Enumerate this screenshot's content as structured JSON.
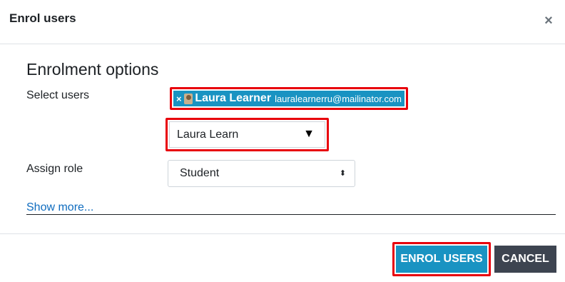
{
  "modal": {
    "title": "Enrol users",
    "close_glyph": "×"
  },
  "enrolment": {
    "heading": "Enrolment options",
    "select_users_label": "Select users",
    "selected_user": {
      "remove_glyph": "×",
      "avatar_icon": "user-avatar-icon",
      "name": "Laura Learner",
      "email": "lauralearnerru@mailinator.com"
    },
    "search": {
      "value": "Laura Learn",
      "arrow_glyph": "▼"
    },
    "assign_role_label": "Assign role",
    "role_select": {
      "value": "Student",
      "icon_glyph": "⬍"
    },
    "show_more": "Show more..."
  },
  "footer": {
    "enrol_label": "ENROL USERS",
    "cancel_label": "CANCEL"
  },
  "colors": {
    "accent": "#1993c2",
    "highlight": "#e8000b",
    "cancel_bg": "#3d4450",
    "link": "#0f6cbf"
  }
}
